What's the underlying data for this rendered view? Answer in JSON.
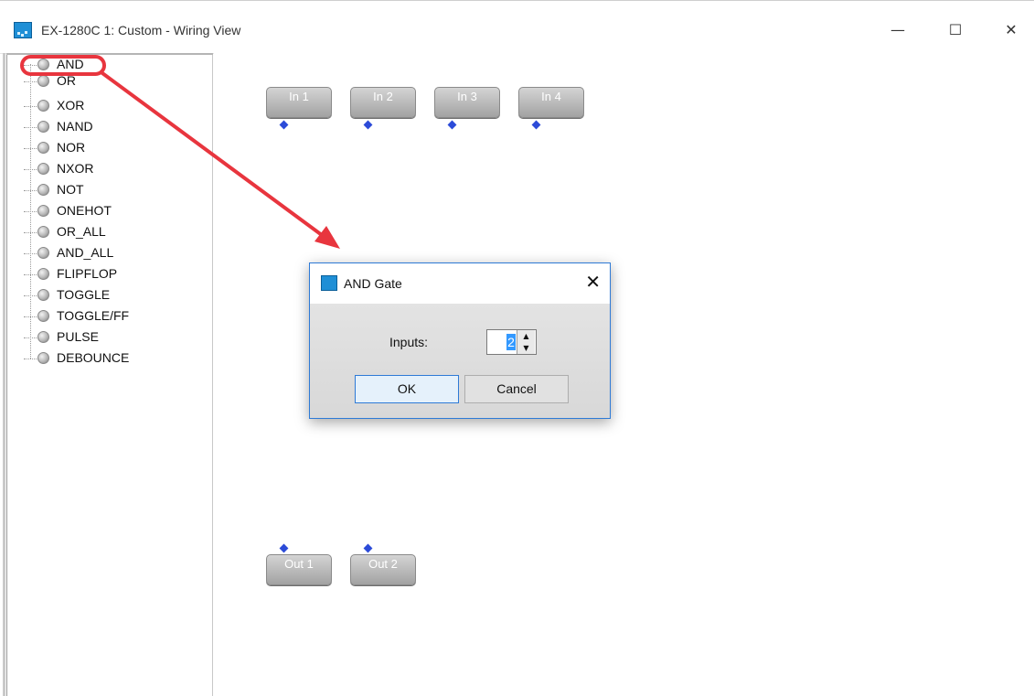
{
  "window": {
    "title": "EX-1280C 1: Custom - Wiring View",
    "minimize_glyph": "—",
    "maximize_glyph": "☐",
    "close_glyph": "✕"
  },
  "tree": {
    "items": [
      "AND",
      "OR",
      "XOR",
      "NAND",
      "NOR",
      "NXOR",
      "NOT",
      "ONEHOT",
      "OR_ALL",
      "AND_ALL",
      "FLIPFLOP",
      "TOGGLE",
      "TOGGLE/FF",
      "PULSE",
      "DEBOUNCE"
    ],
    "highlighted_item": "AND"
  },
  "canvas": {
    "inputs": [
      "In 1",
      "In 2",
      "In 3",
      "In 4"
    ],
    "outputs": [
      "Out 1",
      "Out 2"
    ]
  },
  "dialog": {
    "title": "AND Gate",
    "close_glyph": "✕",
    "inputs_label": "Inputs:",
    "inputs_value": "2",
    "ok_label": "OK",
    "cancel_label": "Cancel"
  },
  "colors": {
    "annotation": "#e8353e",
    "pin": "#2c4bd8",
    "dialog_border": "#2e7ad6"
  },
  "icons": [
    "app-icon",
    "bulb-icon",
    "connector-pin-icon",
    "close-icon",
    "spin-up-icon",
    "spin-down-icon"
  ]
}
